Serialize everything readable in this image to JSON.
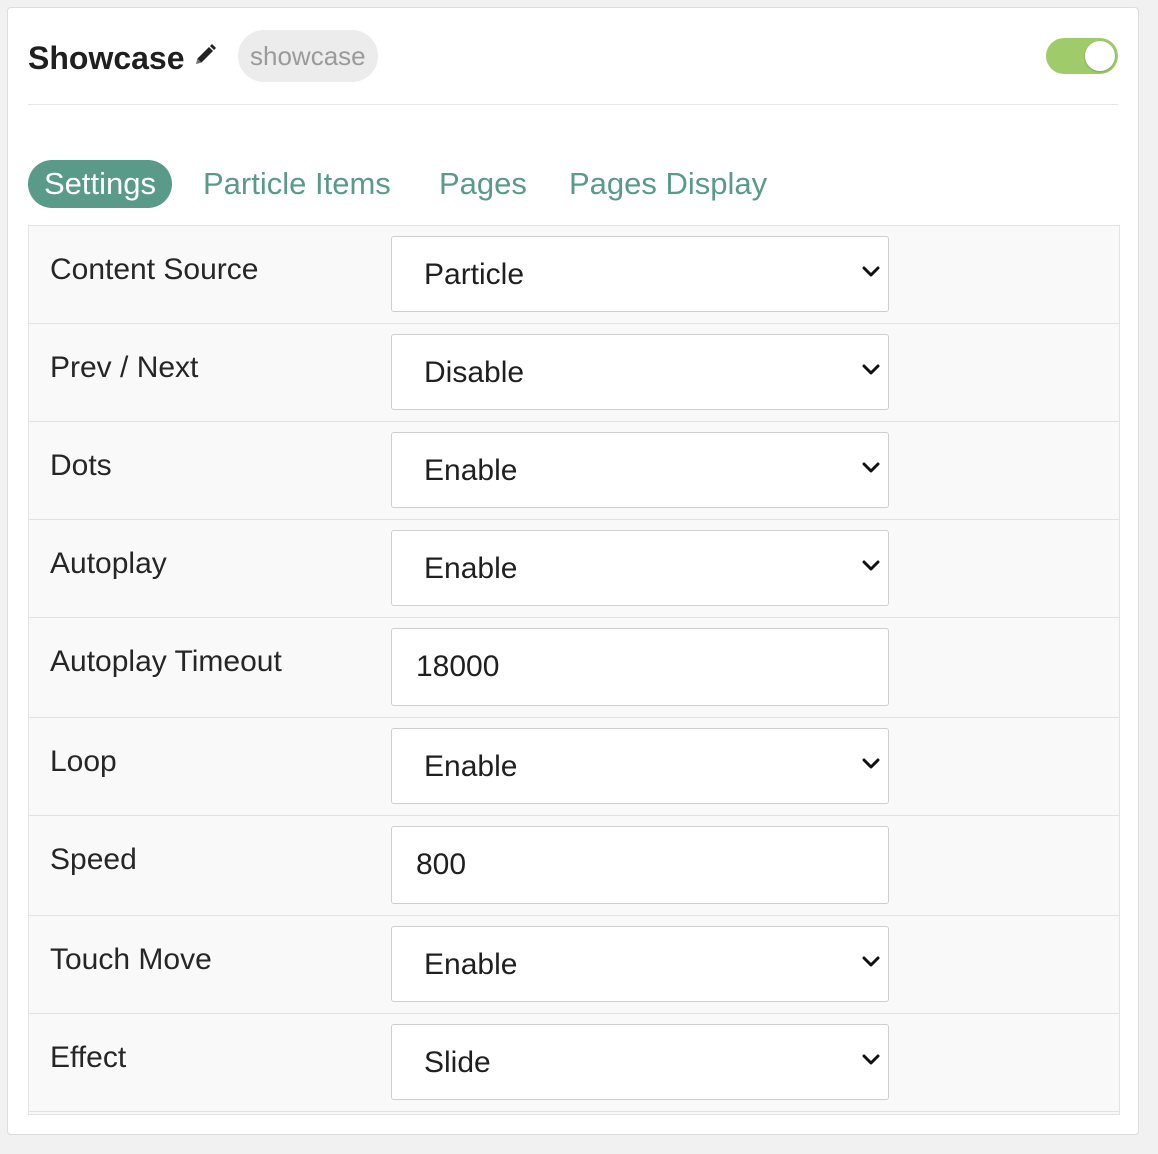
{
  "header": {
    "title": "Showcase",
    "badge": "showcase",
    "toggle_on": true,
    "accent_color": "#5a9a89",
    "toggle_color": "#9fcb6b"
  },
  "tabs": [
    {
      "label": "Settings",
      "active": true
    },
    {
      "label": "Particle Items",
      "active": false
    },
    {
      "label": "Pages",
      "active": false
    },
    {
      "label": "Pages Display",
      "active": false
    }
  ],
  "settings": [
    {
      "label": "Content Source",
      "type": "select",
      "value": "Particle"
    },
    {
      "label": "Prev / Next",
      "type": "select",
      "value": "Disable"
    },
    {
      "label": "Dots",
      "type": "select",
      "value": "Enable"
    },
    {
      "label": "Autoplay",
      "type": "select",
      "value": "Enable"
    },
    {
      "label": "Autoplay Timeout",
      "type": "text",
      "value": "18000"
    },
    {
      "label": "Loop",
      "type": "select",
      "value": "Enable"
    },
    {
      "label": "Speed",
      "type": "text",
      "value": "800"
    },
    {
      "label": "Touch Move",
      "type": "select",
      "value": "Enable"
    },
    {
      "label": "Effect",
      "type": "select",
      "value": "Slide"
    }
  ]
}
